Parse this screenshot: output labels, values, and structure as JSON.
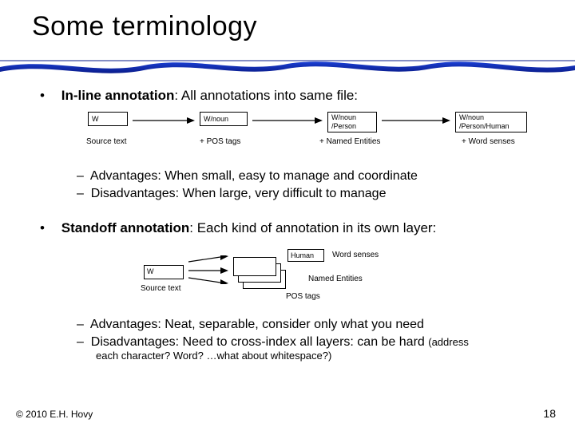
{
  "title": "Some terminology",
  "bullets": {
    "inline": {
      "label": "In-line annotation",
      "desc": ": All annotations into same file:",
      "adv": "Advantages: When small, easy to manage and coordinate",
      "dis": "Disadvantages: When large, very difficult to manage"
    },
    "standoff": {
      "label": "Standoff annotation",
      "desc": ": Each kind of annotation in its own layer:",
      "adv": "Advantages: Neat, separable, consider only what you need",
      "dis": "Disadvantages: Need to cross-index all layers: can be hard",
      "dis_tail": "(address",
      "dis_line2": "each character?  Word?  …what about whitespace?)"
    }
  },
  "diagram_inline": {
    "b1": "W",
    "b2": "W/noun",
    "b3": "W/noun\n/Person",
    "b4": "W/noun\n/Person/Human",
    "c1": "Source text",
    "c2": "+ POS tags",
    "c3": "+ Named Entities",
    "c4": "+ Word senses"
  },
  "diagram_standoff": {
    "srcbox": "W",
    "srccap": "Source text",
    "layer_top_box": "Human",
    "layer_top": "Word senses",
    "layer_mid": "Named Entities",
    "layer_bot": "POS tags"
  },
  "footer": {
    "copyright": "© 2010  E.H. Hovy",
    "page": "18"
  }
}
